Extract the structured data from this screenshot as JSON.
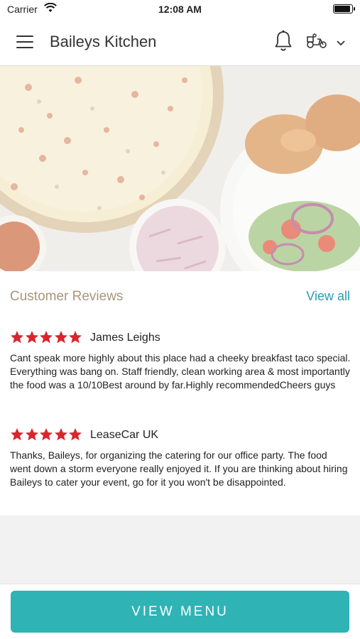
{
  "status_bar": {
    "carrier": "Carrier",
    "time": "12:08 AM"
  },
  "header": {
    "title": "Baileys Kitchen"
  },
  "reviews": {
    "title": "Customer Reviews",
    "view_all": "View all",
    "star_color": "#d9262d",
    "items": [
      {
        "rating": 5,
        "name": "James Leighs",
        "text": "Cant speak more highly about this place had a cheeky breakfast taco special. Everything was bang on. Staff friendly, clean working area & most importantly the food was a 10/10Best around by far.Highly recommendedCheers guys"
      },
      {
        "rating": 5,
        "name": "LeaseCar UK",
        "text": "Thanks, Baileys, for organizing the catering for our office party. The food went down a storm everyone really enjoyed it. If you are thinking about hiring Baileys to cater your event, go for it you won't be disappointed."
      }
    ]
  },
  "footer": {
    "view_menu": "VIEW MENU",
    "button_color": "#2fb3b5"
  }
}
